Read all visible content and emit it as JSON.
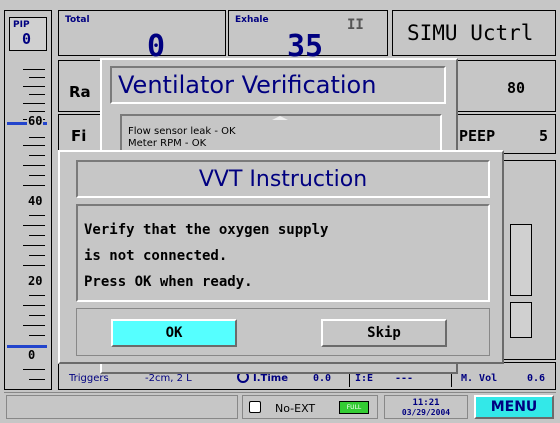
{
  "pip": {
    "label": "PIP",
    "value": "0"
  },
  "total": {
    "label": "Total",
    "value": "0"
  },
  "exhale": {
    "label": "Exhale",
    "value": "35"
  },
  "pause_glyph": "II",
  "mode_title": "SIMU Uctrl",
  "rate": {
    "label": "Ra",
    "value": "80"
  },
  "fio2": {
    "label": "Fi"
  },
  "peep": {
    "label": "PEEP",
    "value": "5"
  },
  "scale": {
    "labels": [
      "60",
      "40",
      "20",
      "0"
    ]
  },
  "bottom_bar": {
    "triggers": "Triggers",
    "trigger_value": "-2cm, 2 L",
    "itime_label": "I.Time",
    "itime_value": "0.0",
    "ie_label": "I:E",
    "ie_value": "---",
    "mvol_label": "M. Vol",
    "mvol_value": "0.6"
  },
  "status": {
    "no_ext": "No-EXT",
    "battery": "FULL",
    "time": "11:21",
    "date": "03/29/2004",
    "menu": "MENU"
  },
  "ventilator_verification": {
    "title": "Ventilator Verification",
    "lines": [
      "Flow sensor leak - OK",
      "Meter RPM - OK"
    ]
  },
  "vvt_dialog": {
    "title": "VVT Instruction",
    "message_lines": [
      "Verify that the oxygen supply",
      "is not connected.",
      "Press OK when ready."
    ],
    "ok_label": "OK",
    "skip_label": "Skip"
  },
  "colors": {
    "background": "#c6c6c6",
    "accent_cyan": "#55ffff",
    "title_navy": "#000080",
    "menu_cyan": "#33e8e8",
    "battery_green": "#33cc33"
  }
}
